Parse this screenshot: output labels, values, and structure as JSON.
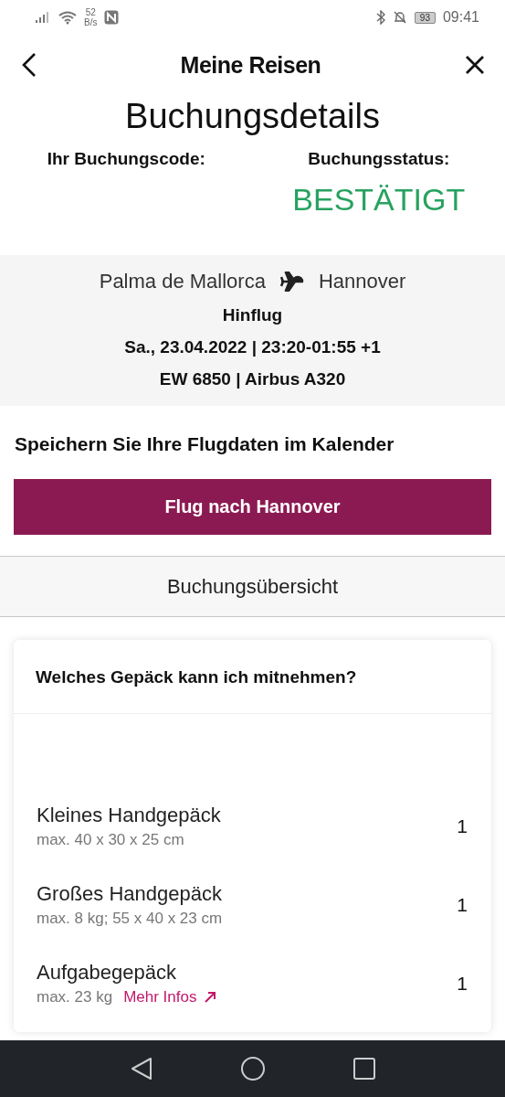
{
  "status_bar": {
    "speed_value": "52",
    "speed_unit": "B/s",
    "battery": "93",
    "time": "09:41"
  },
  "header": {
    "title": "Meine Reisen"
  },
  "page_title": "Buchungsdetails",
  "booking": {
    "code_label": "Ihr Buchungscode:",
    "status_label": "Buchungsstatus:",
    "status": "BESTÄTIGT"
  },
  "flight": {
    "from": "Palma de Mallorca",
    "to": "Hannover",
    "direction": "Hinflug",
    "date_time": "Sa., 23.04.2022 | 23:20-01:55 +1",
    "flight_info": "EW 6850 | Airbus A320"
  },
  "calendar": {
    "text": "Speichern Sie Ihre Flugdaten im Kalender",
    "button": "Flug nach Hannover"
  },
  "summary_tab": "Buchungsübersicht",
  "baggage": {
    "title": "Welches Gepäck kann ich mitnehmen?",
    "items": [
      {
        "name": "Kleines Handgepäck",
        "detail": "max. 40 x 30 x 25 cm",
        "count": "1"
      },
      {
        "name": "Großes Handgepäck",
        "detail": "max. 8 kg; 55 x 40 x 23 cm",
        "count": "1"
      },
      {
        "name": "Aufgabegepäck",
        "detail": "max. 23 kg",
        "link": "Mehr Infos",
        "count": "1"
      }
    ]
  }
}
